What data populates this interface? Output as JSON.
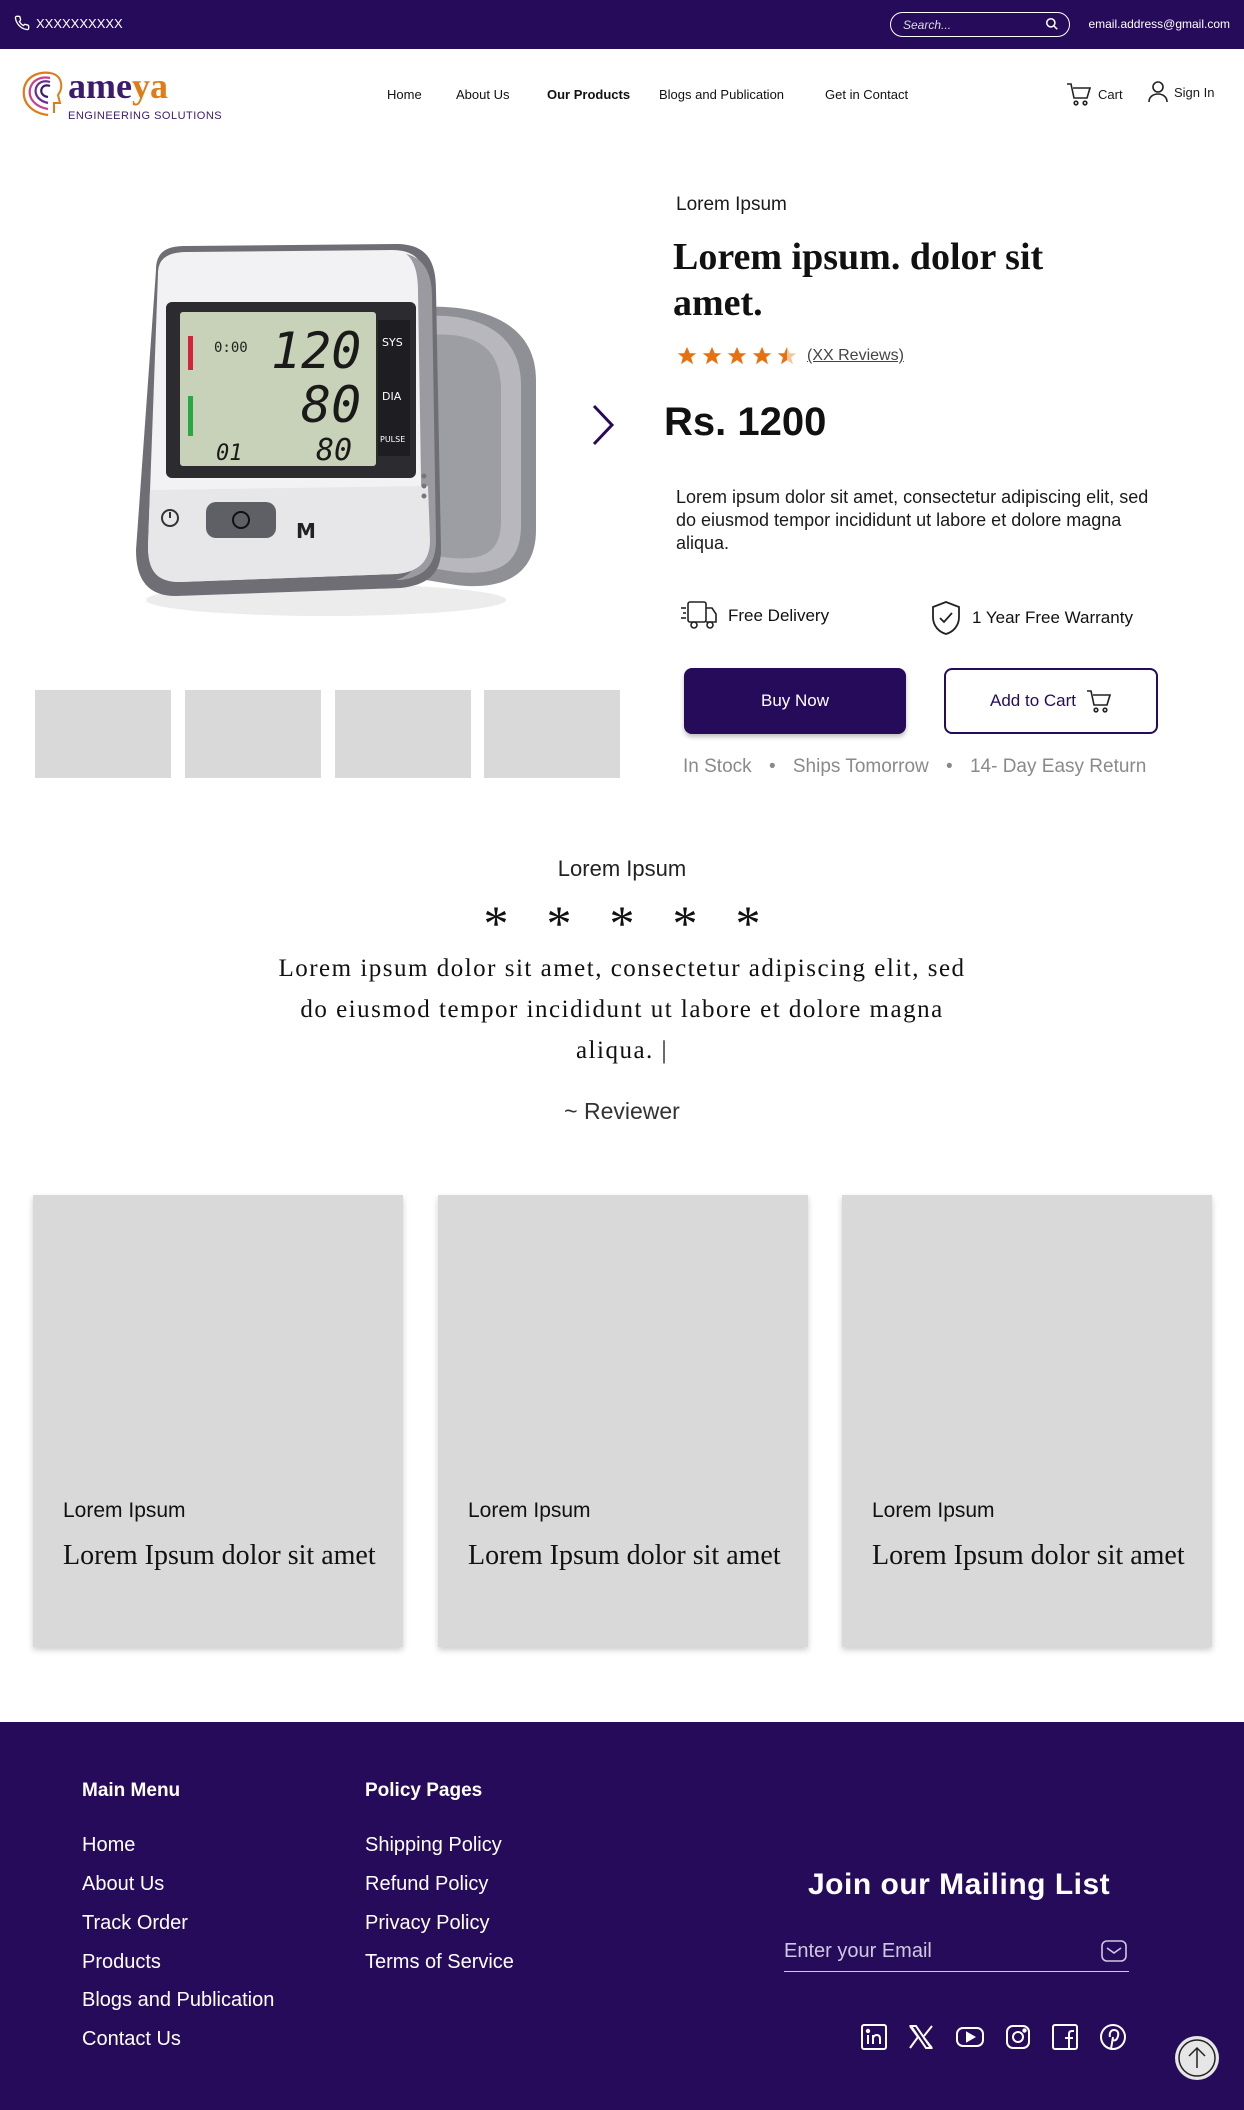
{
  "topbar": {
    "phone": "XXXXXXXXXX",
    "search_placeholder": "Search...",
    "email": "email.address@gmail.com"
  },
  "header": {
    "logo_word_a": "ame",
    "logo_word_b": "ya",
    "logo_sub": "ENGINEERING SOLUTIONS",
    "nav": [
      "Home",
      "About Us",
      "Our Products",
      "Blogs and Publication",
      "Get in Contact"
    ],
    "active_nav": "Our Products",
    "cart_label": "Cart",
    "signin_label": "Sign In"
  },
  "product": {
    "category": "Lorem Ipsum",
    "title": "Lorem ipsum. dolor sit amet.",
    "rating": 4.5,
    "reviews": "(XX Reviews)",
    "price": "Rs. 1200",
    "description": "Lorem ipsum dolor sit amet, consectetur adipiscing elit, sed do eiusmod tempor incididunt ut labore et dolore magna aliqua.",
    "features": [
      "Free Delivery",
      "1 Year Free Warranty"
    ],
    "buy_label": "Buy Now",
    "cart_label": "Add to Cart",
    "stock": "In Stock",
    "shipping": "Ships Tomorrow",
    "returns": "14- Day Easy Return",
    "device": {
      "readout_time": "0:00",
      "readout_sys": "120",
      "readout_dia": "80",
      "readout_pulse": "80",
      "readout_pulse_small": "01",
      "label_sys": "SYS",
      "label_dia": "DIA",
      "label_pulse": "PULSE",
      "button_m": "M"
    }
  },
  "review": {
    "label": "Lorem Ipsum",
    "stars": "*****",
    "text": "Lorem ipsum dolor sit amet, consectetur adipiscing elit, sed do eiusmod tempor incididunt ut labore et dolore magna aliqua. |",
    "author": "~  Reviewer"
  },
  "cards": [
    {
      "label": "Lorem Ipsum",
      "title": "Lorem Ipsum dolor sit amet"
    },
    {
      "label": "Lorem Ipsum",
      "title": "Lorem Ipsum dolor sit amet"
    },
    {
      "label": "Lorem Ipsum",
      "title": "Lorem Ipsum dolor sit amet"
    }
  ],
  "footer": {
    "main_menu_title": "Main Menu",
    "main_menu": [
      "Home",
      "About Us",
      "Track Order",
      "Products",
      "Blogs and Publication",
      "Contact Us"
    ],
    "policy_title": "Policy Pages",
    "policy": [
      "Shipping Policy",
      "Refund Policy",
      "Privacy Policy",
      "Terms of Service"
    ],
    "mailing_title": "Join our Mailing List",
    "email_placeholder": "Enter your Email",
    "social": [
      "linkedin-icon",
      "x-icon",
      "youtube-icon",
      "instagram-icon",
      "facebook-icon",
      "pinterest-icon"
    ]
  },
  "colors": {
    "brand": "#260b5b",
    "star": "#e8700f",
    "placeholder_grey": "#d9d9d9"
  }
}
